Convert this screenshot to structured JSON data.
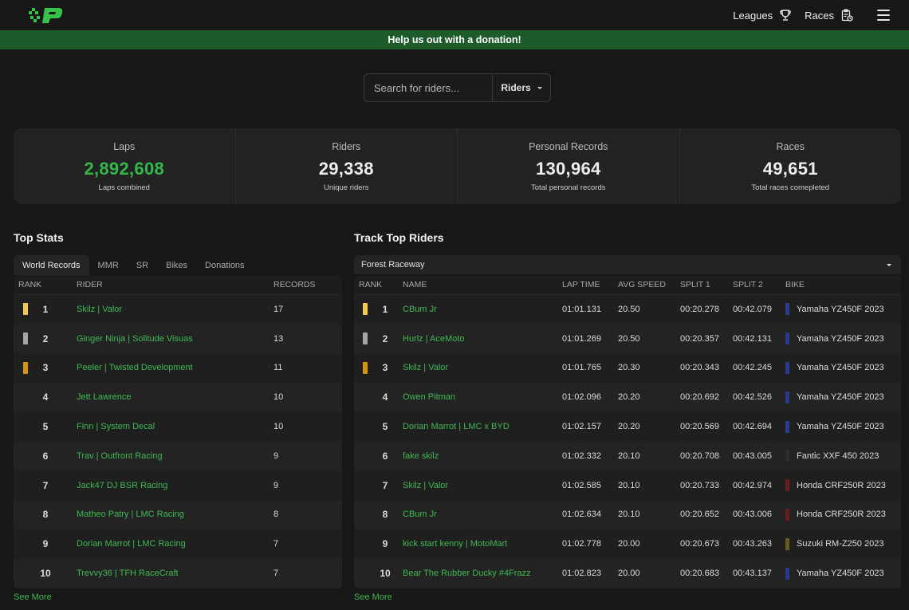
{
  "header": {
    "nav": [
      {
        "label": "Leagues",
        "icon": "trophy-icon"
      },
      {
        "label": "Races",
        "icon": "clipboard-clock-icon"
      }
    ],
    "menu_icon": "hamburger-menu-icon",
    "logo_color": "#37c24c"
  },
  "banner": {
    "text": "Help us out with a donation!",
    "color": "#1e5b2a"
  },
  "search": {
    "placeholder": "Search for riders...",
    "type_selected": "Riders"
  },
  "stats": [
    {
      "label": "Laps",
      "value": "2,892,608",
      "sub": "Laps combined",
      "accent": true
    },
    {
      "label": "Riders",
      "value": "29,338",
      "sub": "Unique riders",
      "accent": false
    },
    {
      "label": "Personal Records",
      "value": "130,964",
      "sub": "Total personal records",
      "accent": false
    },
    {
      "label": "Races",
      "value": "49,651",
      "sub": "Total races comepleted",
      "accent": false
    }
  ],
  "top_stats": {
    "title": "Top Stats",
    "tabs": [
      "World Records",
      "MMR",
      "SR",
      "Bikes",
      "Donations"
    ],
    "active_tab": "World Records",
    "columns": [
      "RANK",
      "RIDER",
      "RECORDS"
    ],
    "rows": [
      {
        "rank": "1",
        "rider": "Skilz | Valor",
        "records": "17"
      },
      {
        "rank": "2",
        "rider": "Ginger Ninja | Solitude Visuas",
        "records": "13"
      },
      {
        "rank": "3",
        "rider": "Peeler | Twisted Development",
        "records": "11"
      },
      {
        "rank": "4",
        "rider": "Jett Lawrence",
        "records": "10"
      },
      {
        "rank": "5",
        "rider": "Finn | System Decal",
        "records": "10"
      },
      {
        "rank": "6",
        "rider": "Trav | Outfront Racing",
        "records": "9"
      },
      {
        "rank": "7",
        "rider": "Jack47 DJ BSR Racing",
        "records": "9"
      },
      {
        "rank": "8",
        "rider": "Matheo Patry | LMC Racing",
        "records": "8"
      },
      {
        "rank": "9",
        "rider": "Dorian Marrot | LMC Racing",
        "records": "7"
      },
      {
        "rank": "10",
        "rider": "Trevvy36 | TFH RaceCraft",
        "records": "7"
      }
    ],
    "see_more": "See More"
  },
  "track_top": {
    "title": "Track Top Riders",
    "track_selected": "Forest Raceway",
    "columns": [
      "RANK",
      "NAME",
      "LAP TIME",
      "AVG SPEED",
      "SPLIT 1",
      "SPLIT 2",
      "BIKE"
    ],
    "rows": [
      {
        "rank": "1",
        "name": "CBum Jr",
        "lap": "01:01.131",
        "speed": "20.50",
        "s1": "00:20.278",
        "s2": "00:42.079",
        "bike": "Yamaha YZ450F 2023",
        "bike_color": "#2a3a8c"
      },
      {
        "rank": "2",
        "name": "Hurlz | AceMoto",
        "lap": "01:01.269",
        "speed": "20.50",
        "s1": "00:20.357",
        "s2": "00:42.131",
        "bike": "Yamaha YZ450F 2023",
        "bike_color": "#2a3a8c"
      },
      {
        "rank": "3",
        "name": "Skilz | Valor",
        "lap": "01:01.765",
        "speed": "20.30",
        "s1": "00:20.343",
        "s2": "00:42.245",
        "bike": "Yamaha YZ450F 2023",
        "bike_color": "#2a3a8c"
      },
      {
        "rank": "4",
        "name": "Owen Pitman",
        "lap": "01:02.096",
        "speed": "20.20",
        "s1": "00:20.692",
        "s2": "00:42.526",
        "bike": "Yamaha YZ450F 2023",
        "bike_color": "#2a3a8c"
      },
      {
        "rank": "5",
        "name": "Dorian Marrot | LMC x BYD",
        "lap": "01:02.157",
        "speed": "20.20",
        "s1": "00:20.569",
        "s2": "00:42.694",
        "bike": "Yamaha YZ450F 2023",
        "bike_color": "#2a3a8c"
      },
      {
        "rank": "6",
        "name": "fake skilz",
        "lap": "01:02.332",
        "speed": "20.10",
        "s1": "00:20.708",
        "s2": "00:43.005",
        "bike": "Fantic XXF 450 2023",
        "bike_color": "#2e2e2e"
      },
      {
        "rank": "7",
        "name": "Skilz | Valor",
        "lap": "01:02.585",
        "speed": "20.10",
        "s1": "00:20.733",
        "s2": "00:42.974",
        "bike": "Honda CRF250R 2023",
        "bike_color": "#6b1e1e"
      },
      {
        "rank": "8",
        "name": "CBum Jr",
        "lap": "01:02.634",
        "speed": "20.10",
        "s1": "00:20.652",
        "s2": "00:43.006",
        "bike": "Honda CRF250R 2023",
        "bike_color": "#6b1e1e"
      },
      {
        "rank": "9",
        "name": "kick start kenny | MotoMart",
        "lap": "01:02.778",
        "speed": "20.00",
        "s1": "00:20.673",
        "s2": "00:43.263",
        "bike": "Suzuki RM-Z250 2023",
        "bike_color": "#6b5a1e"
      },
      {
        "rank": "10",
        "name": "Bear The Rubber Ducky #4Frazz",
        "lap": "01:02.823",
        "speed": "20.00",
        "s1": "00:20.683",
        "s2": "00:43.137",
        "bike": "Yamaha YZ450F 2023",
        "bike_color": "#2a3a8c"
      }
    ],
    "see_more": "See More"
  },
  "rank_colors": {
    "gold": "#f2c94c",
    "silver": "#a6a6a6",
    "bronze": "#d4960f"
  }
}
